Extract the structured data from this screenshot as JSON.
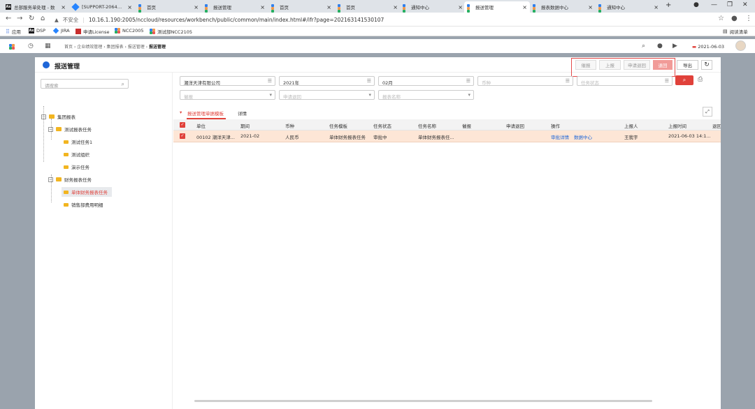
{
  "browser": {
    "tabs": [
      {
        "title": "总部服务单处理 - 数",
        "icon": "ax-icon"
      },
      {
        "title": "[SUPPORT-206492]",
        "icon": "jira-icon"
      },
      {
        "title": "首页",
        "icon": "pinwheel-icon"
      },
      {
        "title": "报送管理",
        "icon": "pinwheel-icon"
      },
      {
        "title": "首页",
        "icon": "pinwheel-icon"
      },
      {
        "title": "首页",
        "icon": "pinwheel-icon"
      },
      {
        "title": "通知中心",
        "icon": "pinwheel-icon"
      },
      {
        "title": "报送管理",
        "icon": "pinwheel-icon",
        "active": true
      },
      {
        "title": "报表数据中心",
        "icon": "pinwheel-icon"
      },
      {
        "title": "通知中心",
        "icon": "pinwheel-icon"
      }
    ],
    "new_tab": "+",
    "security_label": "不安全",
    "url": "10.16.1.190:2005/nccloud/resources/workbench/public/common/main/index.html#/ifr?page=202163141530107",
    "bookmarks": [
      {
        "label": "应用",
        "icon": "apps-grid-icon"
      },
      {
        "label": "DSP",
        "icon": "ax-icon"
      },
      {
        "label": "JIRA",
        "icon": "jira-icon"
      },
      {
        "label": "申请License",
        "icon": "license-icon"
      },
      {
        "label": "NCC2005",
        "icon": "pinwheel-icon"
      },
      {
        "label": "测试部NCC2105",
        "icon": "pinwheel-icon"
      }
    ],
    "reading_list": "阅读清单"
  },
  "app": {
    "breadcrumb": [
      "首页",
      "企业绩效管理",
      "集团报表",
      "报送管理",
      "报送管理"
    ],
    "date": "2021-06-03"
  },
  "page": {
    "title": "报送管理",
    "buttons": {
      "urge": "催报",
      "report": "上报",
      "request_return": "申请退回",
      "return": "退回",
      "export": "导出"
    }
  },
  "tree": {
    "search_placeholder": "请搜索",
    "nodes": [
      {
        "label": "集团报表",
        "level": 0,
        "expandable": true
      },
      {
        "label": "测试报表任务",
        "level": 1,
        "expandable": true
      },
      {
        "label": "测试任务1",
        "level": 2
      },
      {
        "label": "测试组织",
        "level": 2
      },
      {
        "label": "演示任务",
        "level": 2
      },
      {
        "label": "财务报表任务",
        "level": 1,
        "expandable": true
      },
      {
        "label": "单体财务报表任务",
        "level": 2,
        "selected": true
      },
      {
        "label": "销售部费用明细",
        "level": 2
      }
    ]
  },
  "filters": {
    "org": "潮洋天津有限公司",
    "year": "2021年",
    "month": "02月",
    "currency_placeholder": "币种",
    "task_status_placeholder": "任务状态",
    "urge_placeholder": "催报",
    "request_return_placeholder": "申请退回",
    "report_name_placeholder": "报表名称"
  },
  "content_tabs": [
    {
      "label": "报送管理单据模板",
      "active": true
    },
    {
      "label": "详情"
    }
  ],
  "table": {
    "columns": [
      "单位",
      "期间",
      "币种",
      "任务模板",
      "任务状态",
      "任务名称",
      "催报",
      "申请退回",
      "操作",
      "上报人",
      "上报时间",
      "退回"
    ],
    "rows": [
      {
        "unit": "00102 潮洋天津...",
        "period": "2021-02",
        "currency": "人民币",
        "template": "单体财务报表任务",
        "status": "审批中",
        "task_name": "单体财务报表任...",
        "urge": "",
        "request_return": "",
        "actions": [
          "审批详情",
          "数据中心"
        ],
        "reporter": "王我宇",
        "report_time": "2021-06-03 14:1..."
      }
    ]
  },
  "colors": {
    "accent": "#e0413a",
    "selected_row": "#fde6d6",
    "link": "#1e66d8",
    "primary_btn": "#f19b98"
  }
}
